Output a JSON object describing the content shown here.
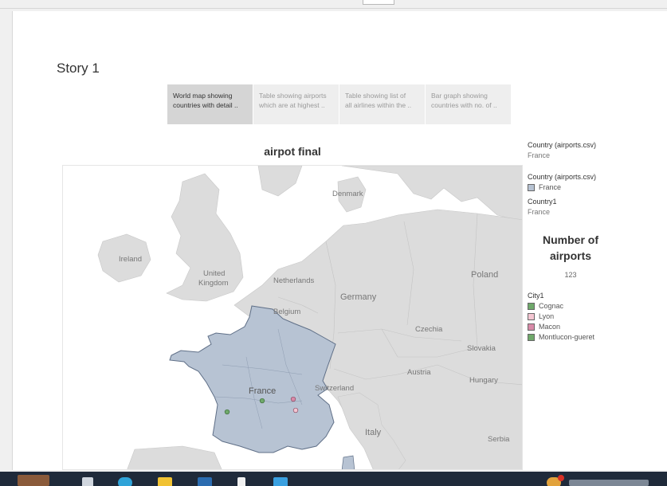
{
  "story": {
    "title": "Story 1",
    "tabs": [
      {
        "line1": "World map showing",
        "line2": "countries with detail ..",
        "active": true
      },
      {
        "line1": "Table showing airports",
        "line2": "which are at highest ..",
        "active": false
      },
      {
        "line1": "Table showing list of",
        "line2": "all airlines within the ..",
        "active": false
      },
      {
        "line1": "Bar graph showing",
        "line2": "countries with no. of ..",
        "active": false
      }
    ]
  },
  "viz": {
    "title": "airpot final"
  },
  "map": {
    "labels": {
      "denmark": "Denmark",
      "ireland": "Ireland",
      "uk_line1": "United",
      "uk_line2": "Kingdom",
      "netherlands": "Netherlands",
      "belgium": "Belgium",
      "germany": "Germany",
      "poland": "Poland",
      "czechia": "Czechia",
      "slovakia": "Slovakia",
      "austria": "Austria",
      "hungary": "Hungary",
      "switzerland": "Switzerland",
      "france": "France",
      "italy": "Italy",
      "serbia": "Serbia"
    },
    "highlight_color": "#b7c3d3",
    "land_color": "#dcdcdc",
    "sea_color": "#ffffff"
  },
  "side": {
    "filter1": {
      "header": "Country (airports.csv)",
      "value": "France"
    },
    "filter2": {
      "header": "Country (airports.csv)",
      "value": "France",
      "color": "#b7c3d3"
    },
    "filter3": {
      "header": "Country1",
      "value": "France"
    },
    "kpi": {
      "title_line1": "Number of",
      "title_line2": "airports",
      "value": "123"
    },
    "city_legend": {
      "header": "City1",
      "items": [
        {
          "label": "Cognac",
          "color": "#6fa96b"
        },
        {
          "label": "Lyon",
          "color": "#f4c6d2"
        },
        {
          "label": "Macon",
          "color": "#d88aa8"
        },
        {
          "label": "Montlucon-gueret",
          "color": "#6fa96b"
        }
      ]
    }
  }
}
